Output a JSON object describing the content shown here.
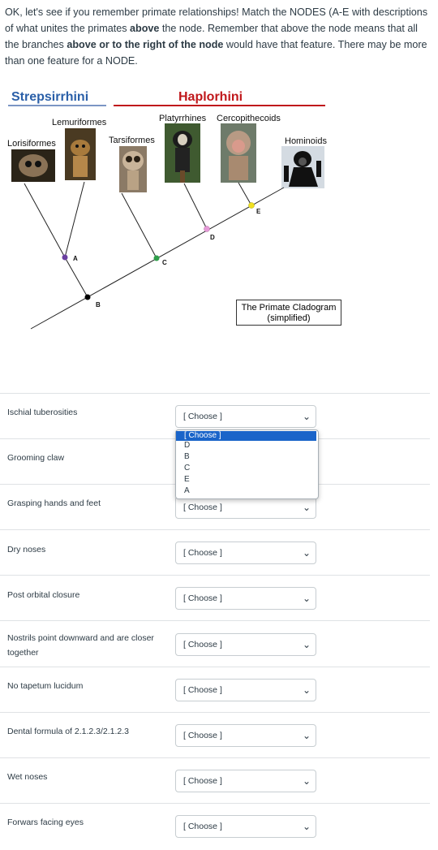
{
  "intro": {
    "p1": "OK, let's see if you remember primate relationships! Match the NODES (A-E with descriptions of what unites the primates ",
    "b1": "above",
    "p2": " the node. Remember that above the node means that all the branches ",
    "b2": "above or to the right of the node",
    "p3": " would have that feature. There may be more than one feature for a NODE."
  },
  "cladogram": {
    "group_left": "Strepsirrhini",
    "group_right": "Haplorhini",
    "taxa": [
      "Lorisiformes",
      "Lemuriformes",
      "Tarsiformes",
      "Platyrrhines",
      "Cercopithecoids",
      "Hominoids"
    ],
    "nodes": [
      "A",
      "B",
      "C",
      "D",
      "E"
    ],
    "caption_line1": "The Primate Cladogram",
    "caption_line2": "(simplified)",
    "colors": {
      "strep": "#2a5fa8",
      "haplo": "#c0171b",
      "A": "#6a3fa0",
      "B": "#000000",
      "C": "#2e9e4a",
      "D": "#e59ad8",
      "E": "#f0e020"
    }
  },
  "questions": [
    {
      "label": "Ischial tuberosities",
      "value": "[ Choose ]"
    },
    {
      "label": "Grooming claw",
      "value": "[ Choose ]"
    },
    {
      "label": "Grasping hands and feet",
      "value": "[ Choose ]"
    },
    {
      "label": "Dry noses",
      "value": "[ Choose ]"
    },
    {
      "label": "Post orbital closure",
      "value": "[ Choose ]"
    },
    {
      "label": "Nostrils point downward and are closer together",
      "value": "[ Choose ]"
    },
    {
      "label": "No tapetum lucidum",
      "value": "[ Choose ]"
    },
    {
      "label": "Dental formula of 2.1.2.3/2.1.2.3",
      "value": "[ Choose ]"
    },
    {
      "label": "Wet noses",
      "value": "[ Choose ]"
    },
    {
      "label": "Forwars facing eyes",
      "value": "[ Choose ]"
    }
  ],
  "dropdown_options": [
    "[ Choose ]",
    "D",
    "B",
    "C",
    "E",
    "A"
  ]
}
